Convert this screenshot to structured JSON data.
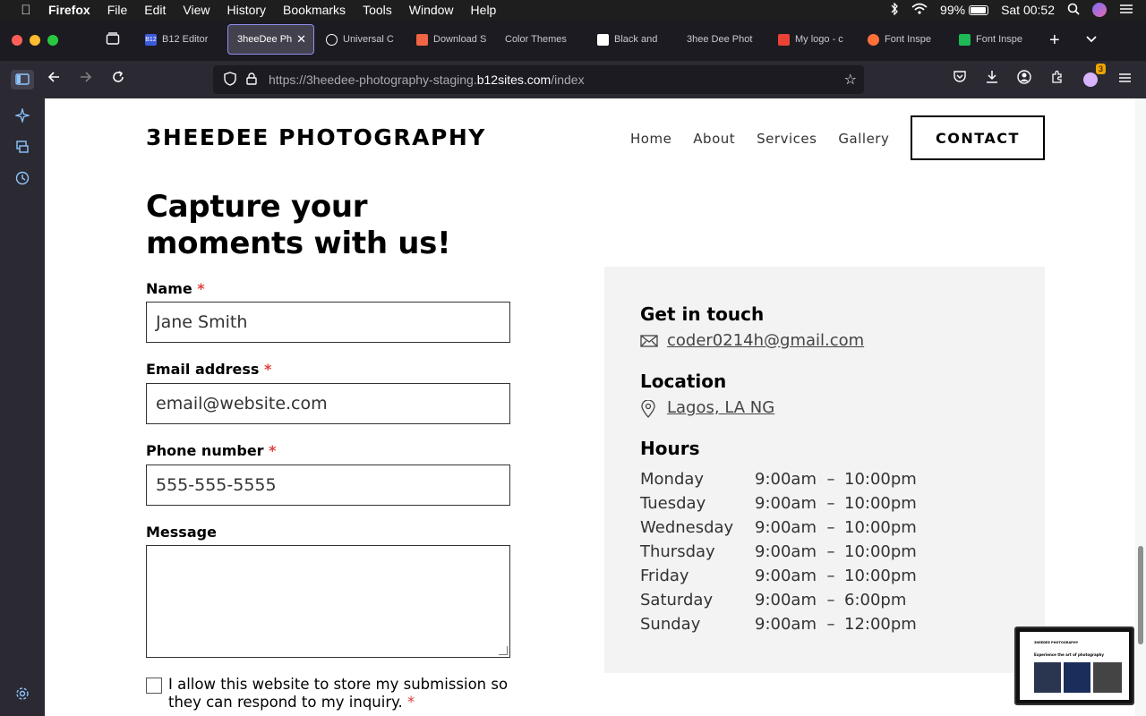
{
  "menubar": {
    "app": "Firefox",
    "items": [
      "File",
      "Edit",
      "View",
      "History",
      "Bookmarks",
      "Tools",
      "Window",
      "Help"
    ],
    "battery": "99%",
    "clock": "Sat 00:52"
  },
  "tabs": [
    {
      "label": "B12 Editor",
      "fav_color": "#3b5bdb"
    },
    {
      "label": "3heeDee Ph",
      "fav_color": "",
      "active": true
    },
    {
      "label": "Universal C",
      "fav_color": "#ffffff"
    },
    {
      "label": "Download S",
      "fav_color": "#f06543"
    },
    {
      "label": "Color Themes",
      "fav_color": ""
    },
    {
      "label": "Black and",
      "fav_color": "#ffffff"
    },
    {
      "label": "3hee Dee Phot",
      "fav_color": ""
    },
    {
      "label": "My logo - c",
      "fav_color": "#ea4335"
    },
    {
      "label": "Font Inspe",
      "fav_color": "#ff7139"
    },
    {
      "label": "Font Inspe",
      "fav_color": "#1db954"
    }
  ],
  "toolbar": {
    "url_pre": "https://3heedee-photography-staging.",
    "url_host": "b12sites.com",
    "url_post": "/index",
    "extension_badge": "3"
  },
  "site": {
    "brand": "3HEEDEE PHOTOGRAPHY",
    "nav": [
      "Home",
      "About",
      "Services",
      "Gallery"
    ],
    "contact_button": "CONTACT",
    "hero_title": "Capture your moments with us!"
  },
  "form": {
    "name_label": "Name",
    "name_value": "Jane Smith",
    "email_label": "Email address",
    "email_value": "email@website.com",
    "phone_label": "Phone number",
    "phone_value": "555-555-5555",
    "message_label": "Message",
    "required_mark": "*",
    "consent_text": "I allow this website to store my submission so they can respond to my inquiry."
  },
  "info": {
    "get_in_touch": "Get in touch",
    "email": "coder0214h@gmail.com",
    "location_title": "Location",
    "location": "Lagos, LA NG",
    "hours_title": "Hours",
    "hours": [
      {
        "day": "Monday",
        "open": "9:00am",
        "sep": "–",
        "close": "10:00pm"
      },
      {
        "day": "Tuesday",
        "open": "9:00am",
        "sep": "–",
        "close": "10:00pm"
      },
      {
        "day": "Wednesday",
        "open": "9:00am",
        "sep": "–",
        "close": "10:00pm"
      },
      {
        "day": "Thursday",
        "open": "9:00am",
        "sep": "–",
        "close": "10:00pm"
      },
      {
        "day": "Friday",
        "open": "9:00am",
        "sep": "–",
        "close": "10:00pm"
      },
      {
        "day": "Saturday",
        "open": "9:00am",
        "sep": "–",
        "close": "6:00pm"
      },
      {
        "day": "Sunday",
        "open": "9:00am",
        "sep": "–",
        "close": "12:00pm"
      }
    ]
  },
  "minimap": {
    "brand": "3HEEDEE PHOTOGRAPHY",
    "headline": "Experience the art of photography"
  }
}
